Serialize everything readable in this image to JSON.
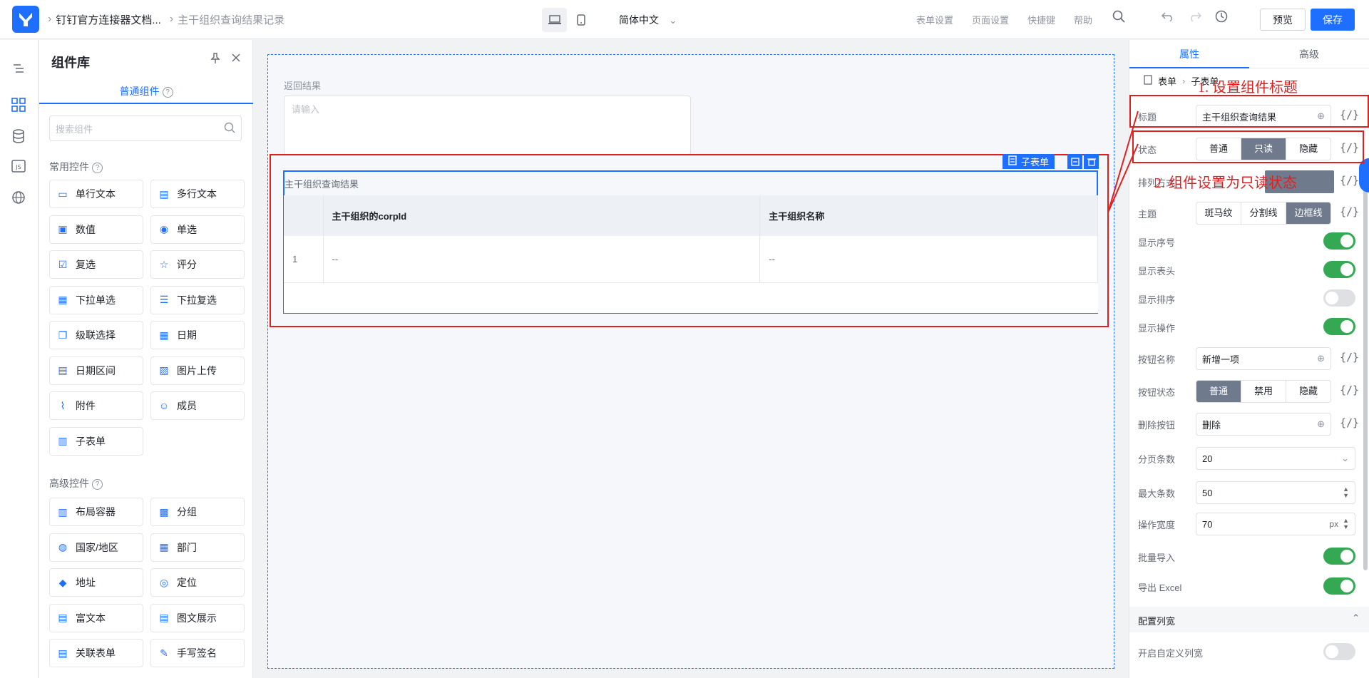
{
  "topbar": {
    "app_name": "钉钉官方连接器文档...",
    "page_name": "主干组织查询结果记录",
    "language": "简体中文",
    "links": [
      "表单设置",
      "页面设置",
      "快捷键",
      "帮助"
    ],
    "preview": "预览",
    "save": "保存"
  },
  "panel": {
    "title": "组件库",
    "tab": "普通组件",
    "search_placeholder": "搜索组件",
    "group_common": "常用控件",
    "group_advanced": "高级控件",
    "common": [
      {
        "label": "单行文本",
        "icon": "text-line-icon"
      },
      {
        "label": "多行文本",
        "icon": "text-multi-icon"
      },
      {
        "label": "数值",
        "icon": "number-icon"
      },
      {
        "label": "单选",
        "icon": "radio-icon"
      },
      {
        "label": "复选",
        "icon": "checkbox-icon"
      },
      {
        "label": "评分",
        "icon": "star-icon"
      },
      {
        "label": "下拉单选",
        "icon": "select-icon"
      },
      {
        "label": "下拉复选",
        "icon": "multiselect-icon"
      },
      {
        "label": "级联选择",
        "icon": "cascade-icon"
      },
      {
        "label": "日期",
        "icon": "calendar-icon"
      },
      {
        "label": "日期区间",
        "icon": "date-range-icon"
      },
      {
        "label": "图片上传",
        "icon": "image-icon"
      },
      {
        "label": "附件",
        "icon": "attachment-icon"
      },
      {
        "label": "成员",
        "icon": "member-icon"
      },
      {
        "label": "子表单",
        "icon": "subform-icon"
      }
    ],
    "advanced": [
      {
        "label": "布局容器",
        "icon": "layout-icon"
      },
      {
        "label": "分组",
        "icon": "group-icon"
      },
      {
        "label": "国家/地区",
        "icon": "globe-icon"
      },
      {
        "label": "部门",
        "icon": "department-icon"
      },
      {
        "label": "地址",
        "icon": "map-icon"
      },
      {
        "label": "定位",
        "icon": "location-icon"
      },
      {
        "label": "富文本",
        "icon": "richtext-icon"
      },
      {
        "label": "图文展示",
        "icon": "display-icon"
      },
      {
        "label": "关联表单",
        "icon": "link-form-icon"
      },
      {
        "label": "手写签名",
        "icon": "signature-icon"
      }
    ]
  },
  "canvas": {
    "field_label": "返回结果",
    "textarea_placeholder": "请输入",
    "selected_tag": "子表单",
    "subform_title": "主干组织查询结果",
    "columns": [
      "主干组织的corpId",
      "主干组织名称"
    ],
    "rows": [
      [
        "1",
        "--",
        "--"
      ]
    ]
  },
  "props": {
    "tab_attr": "属性",
    "tab_adv": "高级",
    "crumb_form": "表单",
    "crumb_sub": "子表单",
    "title_label": "标题",
    "title_value": "主干组织查询结果",
    "status_label": "状态",
    "status_opts": [
      "普通",
      "只读",
      "隐藏"
    ],
    "layout_label": "排列方式",
    "theme_label": "主题",
    "theme_opts": [
      "斑马纹",
      "分割线",
      "边框线"
    ],
    "show_index": "显示序号",
    "show_header": "显示表头",
    "show_sort": "显示排序",
    "show_ops": "显示操作",
    "btn_name_label": "按钮名称",
    "btn_name_value": "新增一项",
    "btn_status_label": "按钮状态",
    "btn_status_opts": [
      "普通",
      "禁用",
      "隐藏"
    ],
    "del_btn_label": "删除按钮",
    "del_btn_value": "删除",
    "page_size_label": "分页条数",
    "page_size_value": "20",
    "max_label": "最大条数",
    "max_value": "50",
    "op_width_label": "操作宽度",
    "op_width_value": "70",
    "op_width_unit": "px",
    "batch_import": "批量导入",
    "export_excel": "导出 Excel",
    "config_col": "配置列宽",
    "custom_width": "开启自定义列宽",
    "expr": "{/}"
  },
  "annotations": {
    "a1": "1. 设置组件标题",
    "a2": "2. 组件设置为只读状态"
  }
}
